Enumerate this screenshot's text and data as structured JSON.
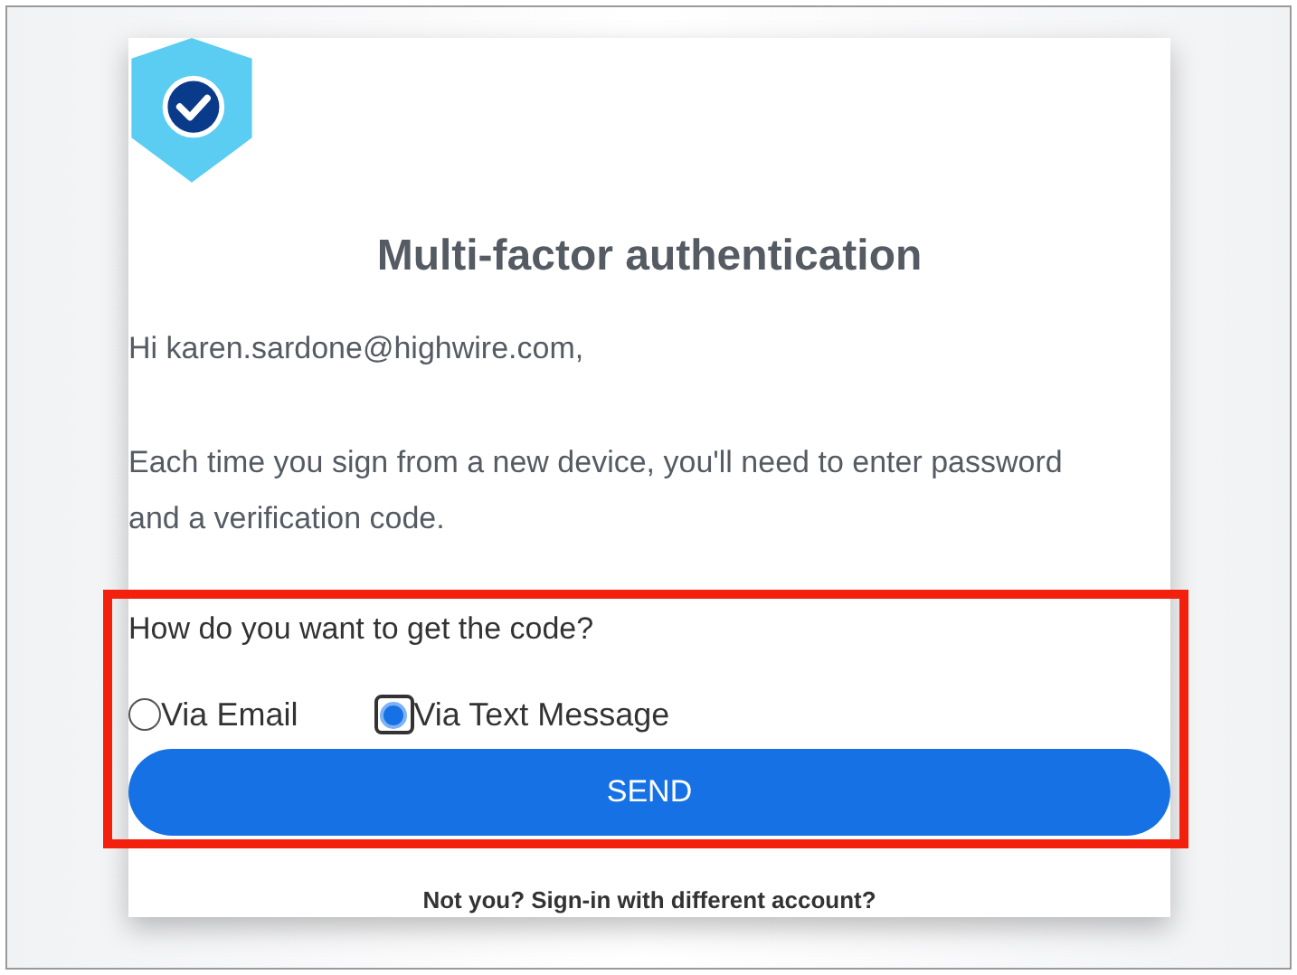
{
  "title": "Multi-factor authentication",
  "greeting": "Hi karen.sardone@highwire.com,",
  "message": "Each time you sign from a new device, you'll need to enter password and a verification code.",
  "question": "How do you want to get the code?",
  "options": [
    {
      "label": "Via Email",
      "selected": false
    },
    {
      "label": "Via Text Message",
      "selected": true
    }
  ],
  "send_button": "SEND",
  "footer_link": "Not you? Sign-in with different account?",
  "highlight": true
}
